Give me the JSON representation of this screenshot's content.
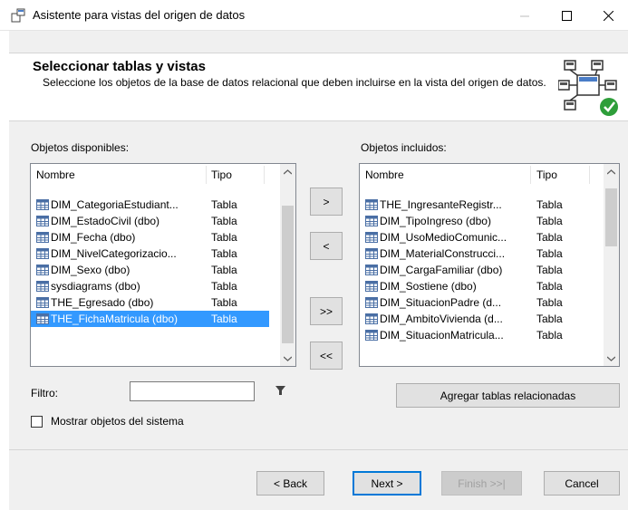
{
  "window": {
    "title": "Asistente para vistas del origen de datos"
  },
  "header": {
    "title": "Seleccionar tablas y vistas",
    "description": "Seleccione los objetos de la base de datos relacional que deben incluirse en la vista del origen de datos."
  },
  "available": {
    "label": "Objetos disponibles:",
    "col_name": "Nombre",
    "col_type": "Tipo",
    "rows": [
      {
        "name": "DIM_CategoriaEstudiant...",
        "type": "Tabla",
        "selected": false
      },
      {
        "name": "DIM_EstadoCivil (dbo)",
        "type": "Tabla",
        "selected": false
      },
      {
        "name": "DIM_Fecha (dbo)",
        "type": "Tabla",
        "selected": false
      },
      {
        "name": "DIM_NivelCategorizacio...",
        "type": "Tabla",
        "selected": false
      },
      {
        "name": "DIM_Sexo (dbo)",
        "type": "Tabla",
        "selected": false
      },
      {
        "name": "sysdiagrams (dbo)",
        "type": "Tabla",
        "selected": false
      },
      {
        "name": "THE_Egresado (dbo)",
        "type": "Tabla",
        "selected": false
      },
      {
        "name": "THE_FichaMatricula (dbo)",
        "type": "Tabla",
        "selected": true
      }
    ]
  },
  "included": {
    "label": "Objetos incluidos:",
    "col_name": "Nombre",
    "col_type": "Tipo",
    "rows": [
      {
        "name": "THE_IngresanteRegistr...",
        "type": "Tabla"
      },
      {
        "name": "DIM_TipoIngreso (dbo)",
        "type": "Tabla"
      },
      {
        "name": "DIM_UsoMedioComunic...",
        "type": "Tabla"
      },
      {
        "name": "DIM_MaterialConstrucci...",
        "type": "Tabla"
      },
      {
        "name": "DIM_CargaFamiliar (dbo)",
        "type": "Tabla"
      },
      {
        "name": "DIM_Sostiene (dbo)",
        "type": "Tabla"
      },
      {
        "name": "DIM_SituacionPadre (d...",
        "type": "Tabla"
      },
      {
        "name": "DIM_AmbitoVivienda (d...",
        "type": "Tabla"
      },
      {
        "name": "DIM_SituacionMatricula...",
        "type": "Tabla"
      }
    ]
  },
  "transfer": {
    "add": ">",
    "remove": "<",
    "add_all": ">>",
    "remove_all": "<<"
  },
  "filter": {
    "label": "Filtro:",
    "value": ""
  },
  "related_button": "Agregar tablas relacionadas",
  "show_system": {
    "label": "Mostrar objetos del sistema",
    "checked": false
  },
  "footer": {
    "back": "< Back",
    "next": "Next >",
    "finish": "Finish >>|",
    "cancel": "Cancel"
  },
  "colors": {
    "selection": "#3399ff",
    "accent": "#0078d7",
    "check_green": "#2e9e3a"
  }
}
